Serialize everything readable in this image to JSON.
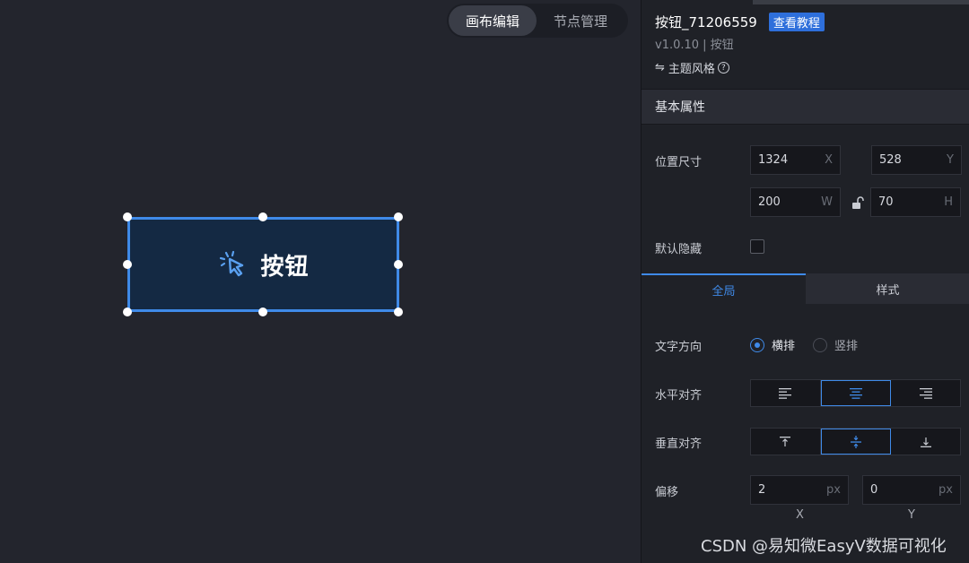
{
  "canvas": {
    "modes": [
      {
        "label": "画布编辑",
        "active": true
      },
      {
        "label": "节点管理",
        "active": false
      }
    ],
    "button": {
      "label": "按钮"
    }
  },
  "panel": {
    "component_name": "按钮_71206559",
    "tutorial_label": "查看教程",
    "version": "v1.0.10 | 按钮",
    "theme_label": "主题风格",
    "section_title": "基本属性",
    "position_size": {
      "label": "位置尺寸",
      "x": {
        "value": "1324",
        "unit": "X"
      },
      "y": {
        "value": "528",
        "unit": "Y"
      },
      "w": {
        "value": "200",
        "unit": "W"
      },
      "h": {
        "value": "70",
        "unit": "H"
      }
    },
    "default_hidden": {
      "label": "默认隐藏",
      "checked": false
    },
    "subtabs": [
      {
        "label": "全局",
        "active": true
      },
      {
        "label": "样式",
        "active": false
      }
    ],
    "text_direction": {
      "label": "文字方向",
      "options": [
        {
          "label": "横排",
          "selected": true
        },
        {
          "label": "竖排",
          "selected": false
        }
      ]
    },
    "h_align": {
      "label": "水平对齐",
      "selected": "center"
    },
    "v_align": {
      "label": "垂直对齐",
      "selected": "middle"
    },
    "offset": {
      "label": "偏移",
      "x": {
        "value": "2",
        "unit": "px",
        "caption": "X"
      },
      "y": {
        "value": "0",
        "unit": "px",
        "caption": "Y"
      }
    }
  },
  "watermark": "CSDN @易知微EasyV数据可视化",
  "colors": {
    "accent": "#3f8ae8",
    "button_fill": "#142943",
    "panel_bg": "#1f2127",
    "canvas_bg": "#23252d"
  }
}
